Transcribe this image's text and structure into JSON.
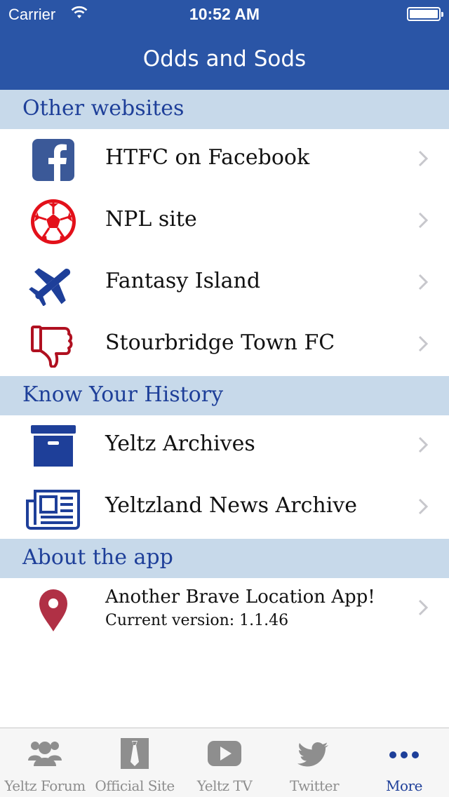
{
  "status_bar": {
    "carrier": "Carrier",
    "time": "10:52 AM"
  },
  "nav": {
    "title": "Odds and Sods"
  },
  "sections": [
    {
      "header": "Other websites",
      "items": [
        {
          "label": "HTFC on Facebook",
          "icon": "facebook-icon"
        },
        {
          "label": "NPL site",
          "icon": "football-icon"
        },
        {
          "label": "Fantasy Island",
          "icon": "airplane-icon"
        },
        {
          "label": "Stourbridge Town FC",
          "icon": "thumbs-down-icon"
        }
      ]
    },
    {
      "header": "Know Your History",
      "items": [
        {
          "label": "Yeltz Archives",
          "icon": "archive-box-icon"
        },
        {
          "label": "Yeltzland News Archive",
          "icon": "newspaper-icon"
        }
      ]
    },
    {
      "header": "About the app",
      "items": [
        {
          "label": "Another Brave Location App!",
          "sublabel": "Current version: 1.1.46",
          "icon": "location-pin-icon"
        }
      ]
    }
  ],
  "tabs": [
    {
      "label": "Yeltz Forum",
      "icon": "group-icon",
      "active": false
    },
    {
      "label": "Official Site",
      "icon": "tie-icon",
      "active": false
    },
    {
      "label": "Yeltz TV",
      "icon": "youtube-icon",
      "active": false
    },
    {
      "label": "Twitter",
      "icon": "twitter-icon",
      "active": false
    },
    {
      "label": "More",
      "icon": "more-icon",
      "active": true
    }
  ],
  "colors": {
    "bar_blue": "#2a55a6",
    "header_bg": "#c7d9ea",
    "header_text": "#1e3f99",
    "active_tab": "#1e3f99"
  }
}
